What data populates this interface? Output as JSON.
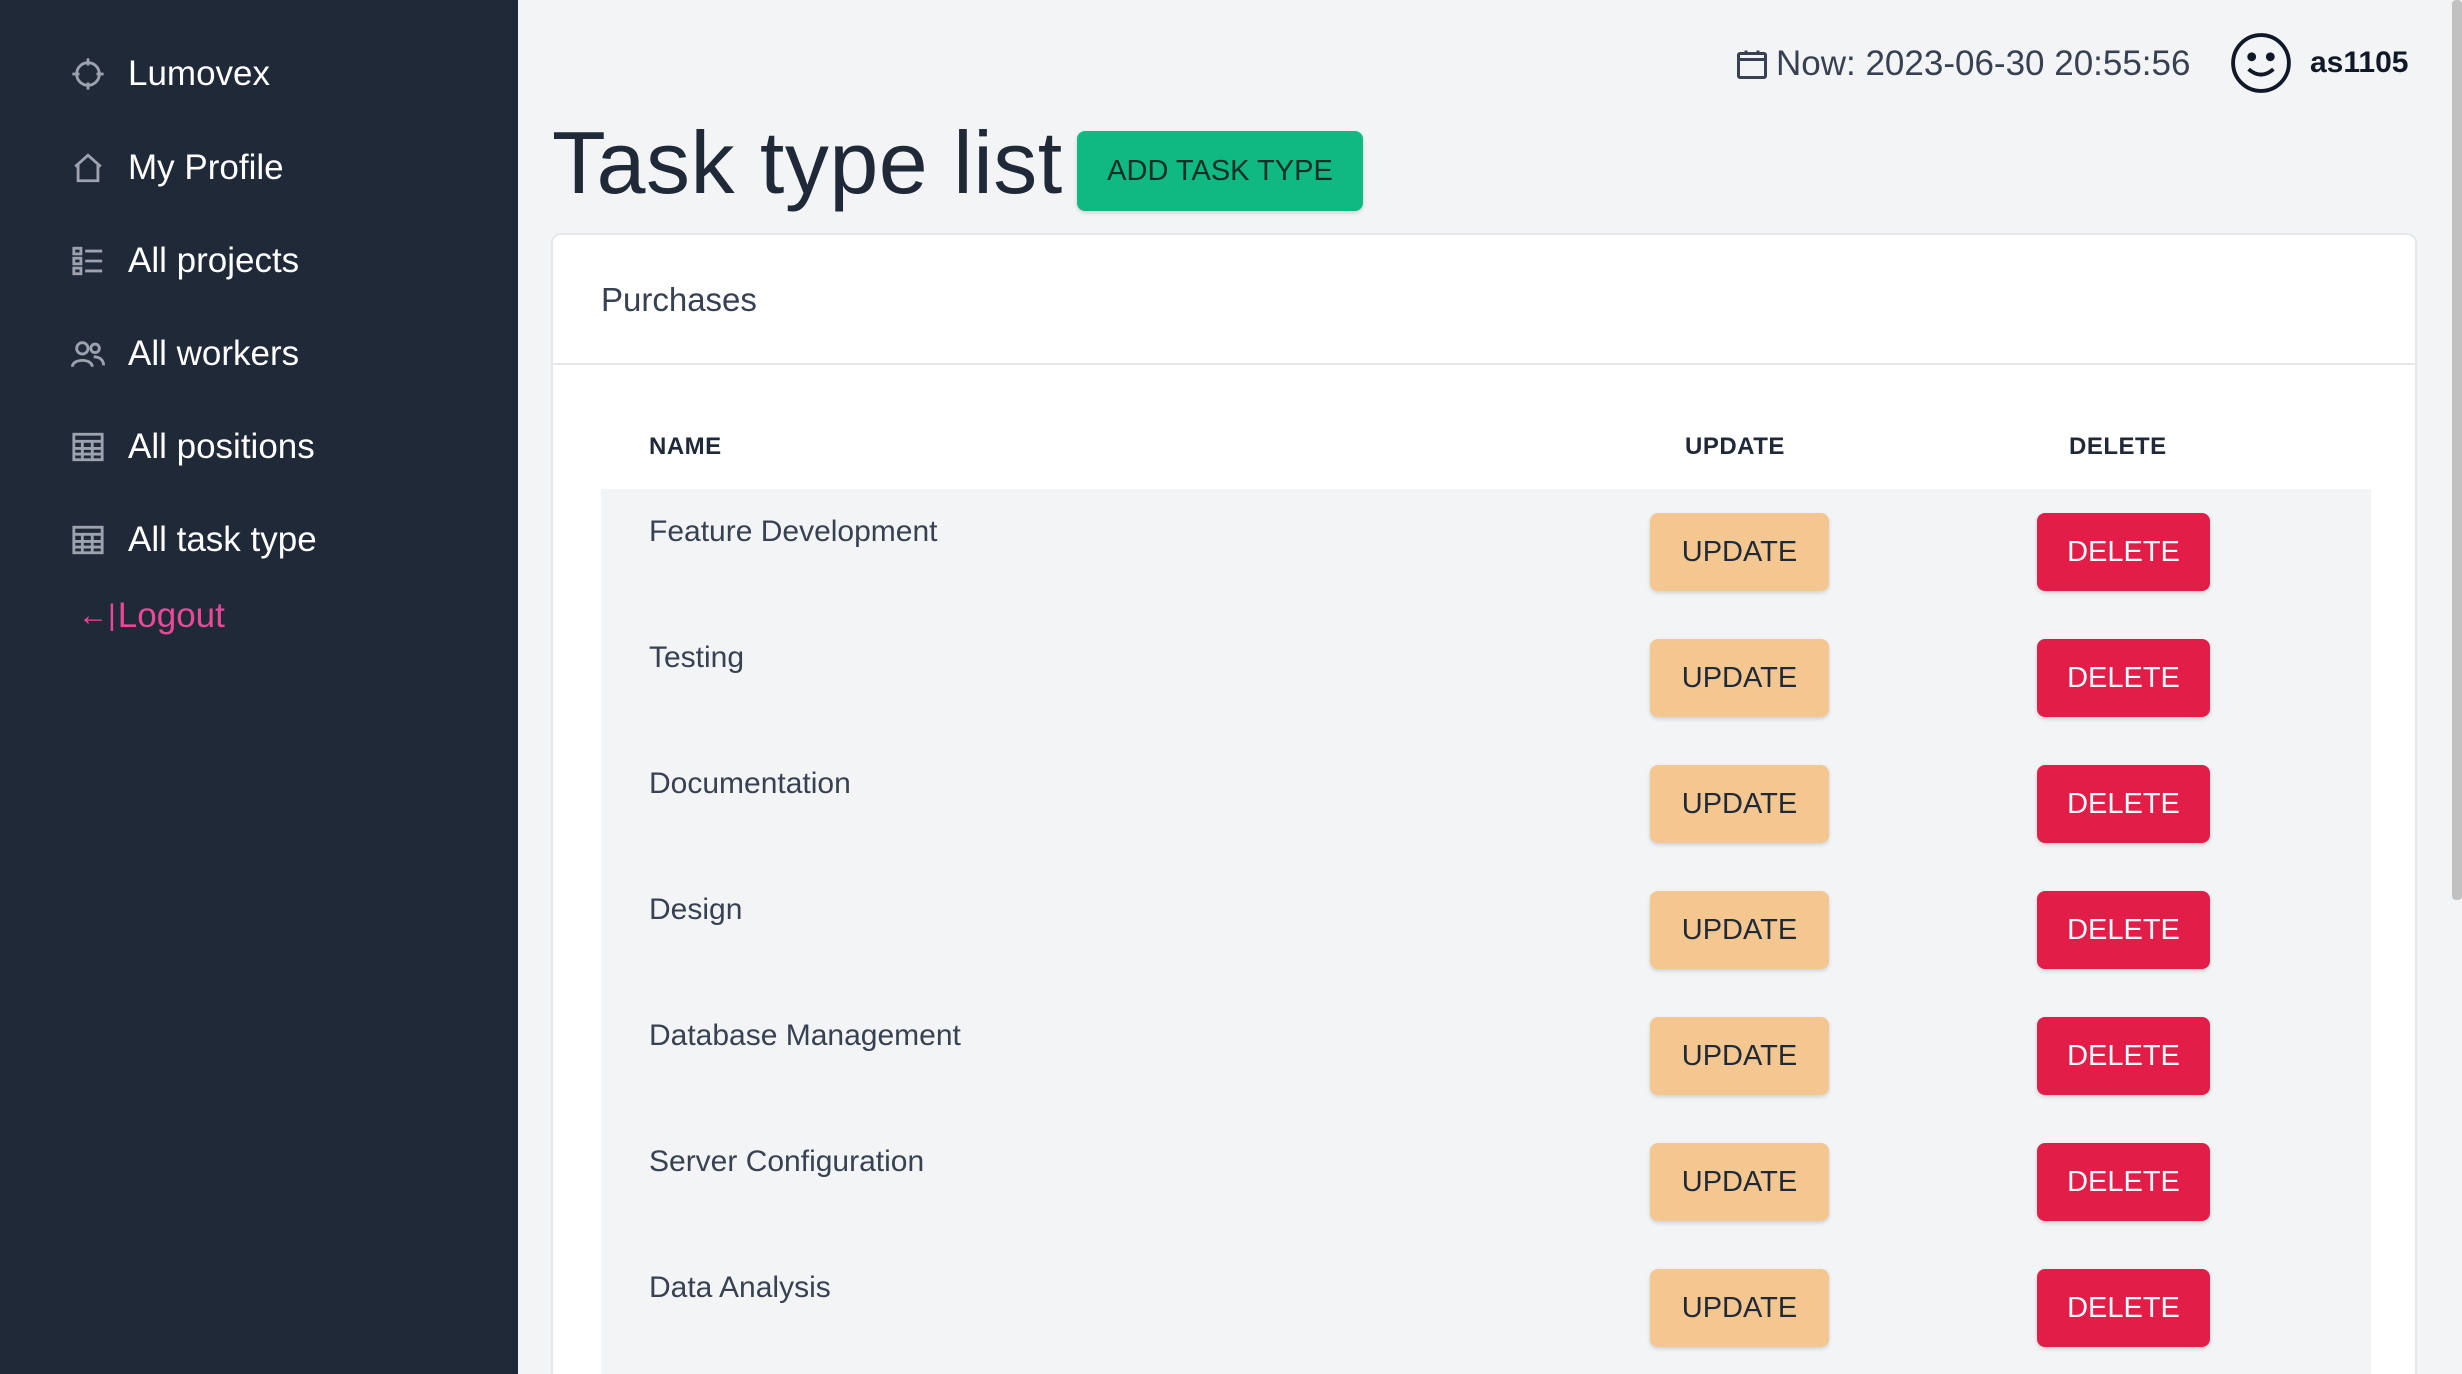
{
  "sidebar": {
    "brand": "Lumovex",
    "items": [
      {
        "label": "My Profile",
        "icon": "home-icon"
      },
      {
        "label": "All projects",
        "icon": "checklist-icon"
      },
      {
        "label": "All workers",
        "icon": "users-icon"
      },
      {
        "label": "All positions",
        "icon": "table-icon"
      },
      {
        "label": "All task type",
        "icon": "table-icon"
      }
    ],
    "logout": {
      "label": "Logout",
      "icon_glyph": "←|"
    }
  },
  "header": {
    "datetime": "Now: 2023-06-30 20:55:56",
    "username": "as1105"
  },
  "page": {
    "title": "Task type list",
    "add_button": "ADD TASK TYPE"
  },
  "card": {
    "title": "Purchases",
    "columns": {
      "name": "NAME",
      "update": "UPDATE",
      "delete": "DELETE"
    },
    "rows": [
      {
        "name": "Feature Development",
        "update": "UPDATE",
        "delete": "DELETE"
      },
      {
        "name": "Testing",
        "update": "UPDATE",
        "delete": "DELETE"
      },
      {
        "name": "Documentation",
        "update": "UPDATE",
        "delete": "DELETE"
      },
      {
        "name": "Design",
        "update": "UPDATE",
        "delete": "DELETE"
      },
      {
        "name": "Database Management",
        "update": "UPDATE",
        "delete": "DELETE"
      },
      {
        "name": "Server Configuration",
        "update": "UPDATE",
        "delete": "DELETE"
      },
      {
        "name": "Data Analysis",
        "update": "UPDATE",
        "delete": "DELETE"
      }
    ]
  },
  "colors": {
    "sidebar_bg": "#1f2937",
    "add_button": "#10b981",
    "update_button": "#f4c790",
    "delete_button": "#e11d48",
    "logout": "#ec4899"
  }
}
